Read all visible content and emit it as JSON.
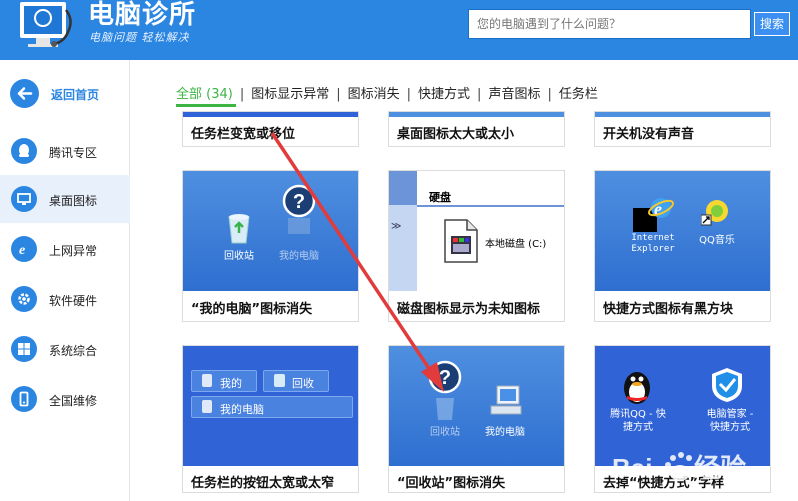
{
  "header": {
    "title": "电脑诊所",
    "slogan": "电脑问题 轻松解决",
    "search_placeholder": "您的电脑遇到了什么问题？",
    "search_button": "搜索"
  },
  "sidebar": {
    "back_label": "返回首页",
    "items": [
      {
        "label": "腾讯专区",
        "icon": "tencent-icon"
      },
      {
        "label": "桌面图标",
        "icon": "monitor-icon",
        "active": true
      },
      {
        "label": "上网异常",
        "icon": "ie-icon"
      },
      {
        "label": "软件硬件",
        "icon": "gear-icon"
      },
      {
        "label": "系统综合",
        "icon": "windows-icon"
      },
      {
        "label": "全国维修",
        "icon": "phone-icon"
      }
    ]
  },
  "tabs": [
    {
      "label": "全部 (34)",
      "active": true
    },
    {
      "label": "图标显示异常"
    },
    {
      "label": "图标消失"
    },
    {
      "label": "快捷方式"
    },
    {
      "label": "声音图标"
    },
    {
      "label": "任务栏"
    }
  ],
  "cards_row1": [
    {
      "caption": "任务栏变宽或移位"
    },
    {
      "caption": "桌面图标太大或太小"
    },
    {
      "caption": "开关机没有声音"
    }
  ],
  "cards_row2": [
    {
      "caption": "“我的电脑”图标消失",
      "thumb_labels": [
        "回收站",
        "我的电脑"
      ]
    },
    {
      "caption": "磁盘图标显示为未知图标",
      "thumb_labels": [
        "硬盘",
        "本地磁盘 (C:)"
      ]
    },
    {
      "caption": "快捷方式图标有黑方块",
      "thumb_labels": [
        "Internet",
        "Explorer",
        "QQ音乐"
      ]
    }
  ],
  "cards_row3": [
    {
      "caption": "任务栏的按钮太宽或太窄",
      "thumb_labels": [
        "我的",
        "回收",
        "我的电脑"
      ]
    },
    {
      "caption": "“回收站”图标消失",
      "thumb_labels": [
        "回收站",
        "我的电脑"
      ]
    },
    {
      "caption": "去掉“快捷方式”字样",
      "thumb_labels": [
        "腾讯QQ - 快",
        "捷方式",
        "电脑管家 -",
        "快捷方式"
      ]
    }
  ],
  "watermark": {
    "text": "Baidu经验"
  },
  "colors": {
    "brand_blue": "#2b86e2",
    "active_green": "#3db545",
    "annotation_red": "#e23b3b"
  }
}
